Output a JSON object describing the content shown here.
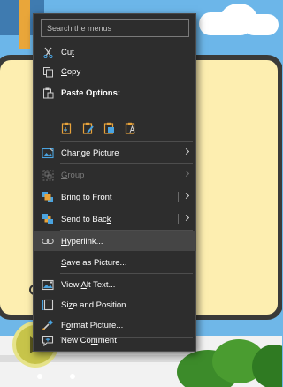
{
  "search": {
    "placeholder": "Search the menus"
  },
  "menu": {
    "cut": {
      "pre": "Cu",
      "key": "t",
      "post": ""
    },
    "copy": {
      "pre": "",
      "key": "C",
      "post": "opy"
    },
    "paste_options": "Paste Options:",
    "paste_icons": [
      "paste-use-destination-theme-icon",
      "paste-keep-source-formatting-icon",
      "paste-picture-icon",
      "paste-keep-text-only-icon"
    ],
    "change_picture": {
      "pre": "Chan",
      "key": "g",
      "post": "e Picture"
    },
    "group": {
      "pre": "",
      "key": "G",
      "post": "roup"
    },
    "bring_to_front": {
      "pre": "Bring to F",
      "key": "r",
      "post": "ont"
    },
    "send_to_back": {
      "pre": "Send to Bac",
      "key": "k",
      "post": ""
    },
    "hyperlink": {
      "pre": "",
      "key": "H",
      "post": "yperlink..."
    },
    "save_as_picture": {
      "pre": "",
      "key": "S",
      "post": "ave as Picture..."
    },
    "view_alt_text": {
      "pre": "View ",
      "key": "A",
      "post": "lt Text..."
    },
    "size_and_position": {
      "pre": "Si",
      "key": "z",
      "post": "e and Position..."
    },
    "format_picture": {
      "pre": "F",
      "key": "o",
      "post": "rmat Picture..."
    },
    "new_comment": {
      "pre": "New Co",
      "key": "m",
      "post": "ment"
    }
  },
  "colors": {
    "menu_bg": "#2d2d2d",
    "hover_bg": "#454545",
    "accent_icon": "#e8a33b",
    "icon_blue": "#4aa3df",
    "disabled_text": "#7a7a7a"
  }
}
